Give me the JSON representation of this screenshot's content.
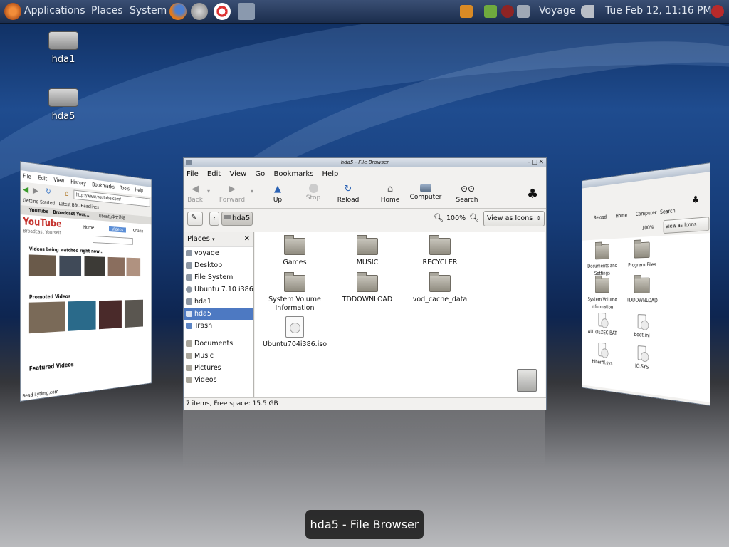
{
  "panel": {
    "menus": [
      "Applications",
      "Places",
      "System"
    ],
    "user": "Voyage",
    "clock": "Tue Feb 12, 11:16 PM"
  },
  "desktop": {
    "icons": [
      {
        "label": "hda1"
      },
      {
        "label": "hda5"
      }
    ]
  },
  "browser_window": {
    "menu": [
      "File",
      "Edit",
      "View",
      "History",
      "Bookmarks",
      "Tools",
      "Help"
    ],
    "url": "http://www.youtube.com/",
    "bookmarks": [
      "Getting Started",
      "Latest BBC Headlines"
    ],
    "tabs": [
      "YouTube - Broadcast Your...",
      "Ubuntu中文论坛"
    ],
    "logo_text": "YouTube",
    "tagline": "Broadcast Yourself",
    "nav": [
      "Home",
      "Videos",
      "Chann"
    ],
    "section_watched": "Videos being watched right now...",
    "section_promoted": "Promoted Videos",
    "section_featured": "Featured Videos",
    "status": "Read i.ytimg.com"
  },
  "file_browser": {
    "title": "hda5 - File Browser",
    "menu": [
      "File",
      "Edit",
      "View",
      "Go",
      "Bookmarks",
      "Help"
    ],
    "toolbar": {
      "back": "Back",
      "forward": "Forward",
      "up": "Up",
      "stop": "Stop",
      "reload": "Reload",
      "home": "Home",
      "computer": "Computer",
      "search": "Search"
    },
    "location": "hda5",
    "zoom": "100%",
    "view_mode": "View as Icons",
    "places_label": "Places",
    "places": [
      "voyage",
      "Desktop",
      "File System",
      "Ubuntu 7.10 i386",
      "hda1",
      "hda5",
      "Trash"
    ],
    "bookmarks": [
      "Documents",
      "Music",
      "Pictures",
      "Videos"
    ],
    "selected_place": "hda5",
    "items": [
      {
        "name": "Games",
        "kind": "folder"
      },
      {
        "name": "MUSIC",
        "kind": "folder"
      },
      {
        "name": "RECYCLER",
        "kind": "folder"
      },
      {
        "name": "System Volume Information",
        "kind": "folder"
      },
      {
        "name": "TDDOWNLOAD",
        "kind": "folder"
      },
      {
        "name": "vod_cache_data",
        "kind": "folder"
      },
      {
        "name": "Ubuntu704i386.iso",
        "kind": "iso"
      }
    ],
    "status": "7 items, Free space: 15.5 GB"
  },
  "right_window": {
    "toolbar": [
      "Reload",
      "Home",
      "Computer",
      "Search"
    ],
    "zoom": "100%",
    "view_mode": "View as Icons",
    "items": [
      "Documents and Settings",
      "Program Files",
      "System Volume Information",
      "TDDOWNLOAD",
      "AUTOEXEC.BAT",
      "boot.ini",
      "hiberfil.sys",
      "IO.SYS"
    ]
  },
  "switcher_caption": "hda5 - File Browser",
  "colors": {
    "selection": "#4d79c2",
    "panel": "#26385a",
    "accent_red": "#c4302b"
  }
}
